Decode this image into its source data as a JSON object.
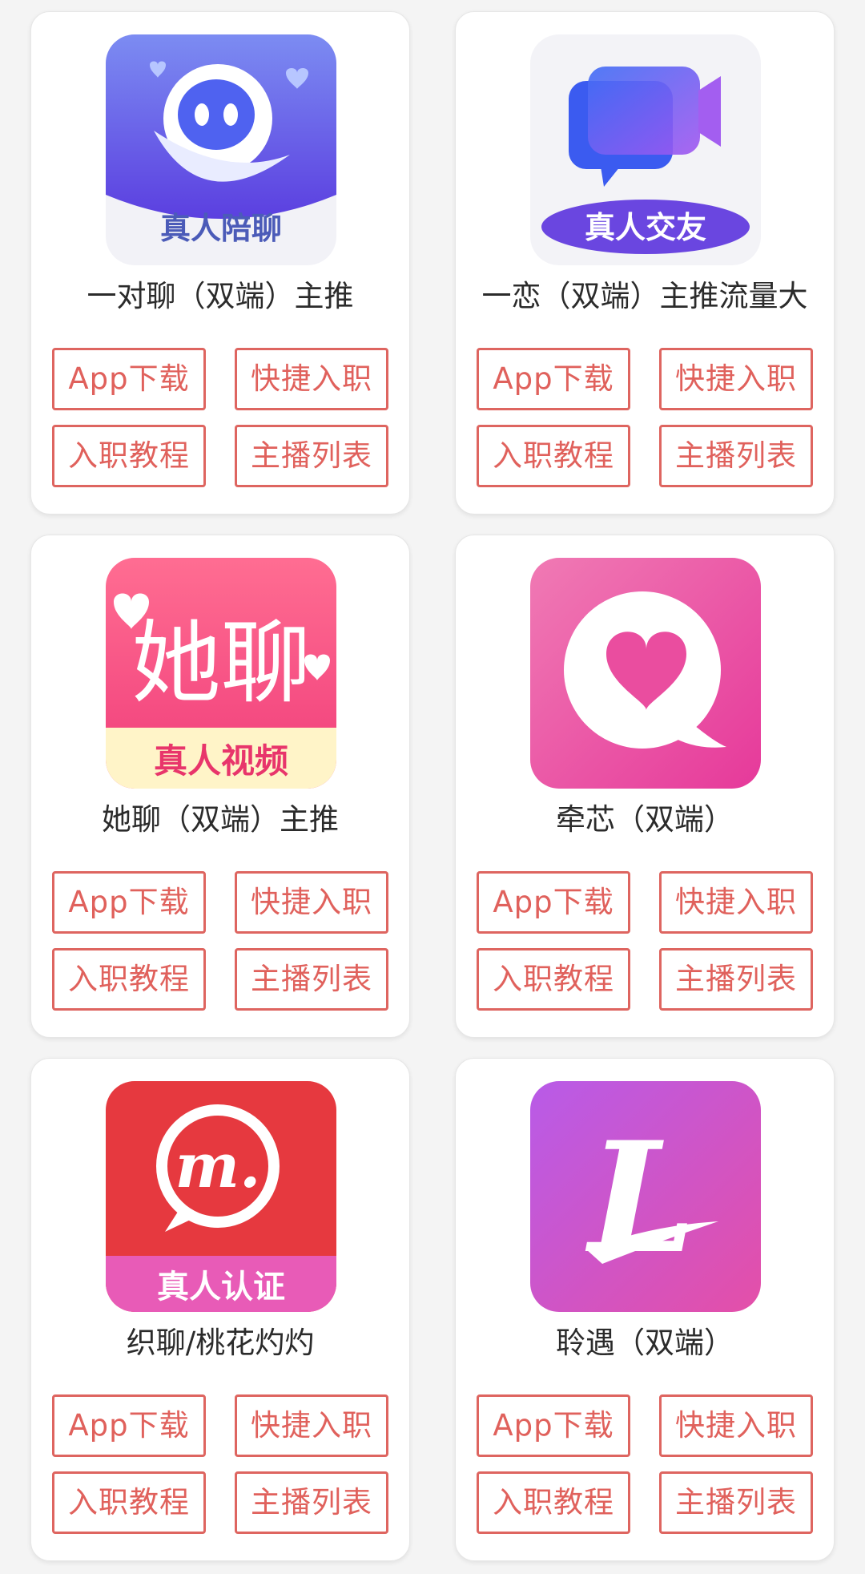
{
  "buttons": {
    "download": "App下载",
    "quick_join": "快捷入职",
    "tutorial": "入职教程",
    "host_list": "主播列表"
  },
  "apps": [
    {
      "name": "一对聊（双端）主推",
      "badge": "真人陪聊"
    },
    {
      "name": "一恋（双端）主推流量大",
      "badge": "真人交友"
    },
    {
      "name": "她聊（双端）主推",
      "badge": "真人视频",
      "logo_text": "她聊"
    },
    {
      "name": "牵芯（双端）"
    },
    {
      "name": "织聊/桃花灼灼",
      "badge": "真人认证",
      "logo_letter": "m."
    },
    {
      "name": "聆遇（双端）",
      "logo_letter": "L"
    }
  ],
  "colors": {
    "button_border": "#de6560",
    "button_text": "#e0615c"
  }
}
